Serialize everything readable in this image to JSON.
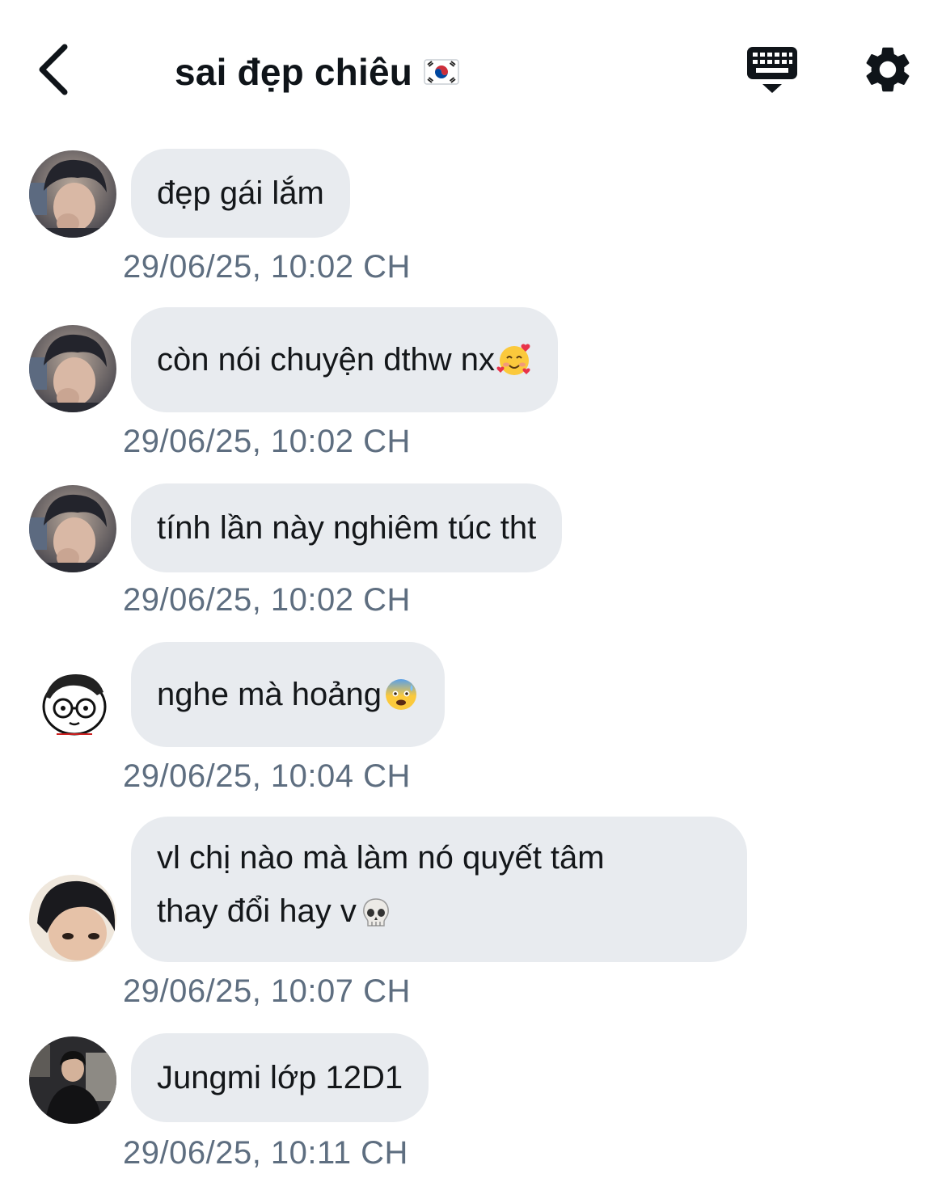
{
  "header": {
    "title": "sai đẹp chiêu",
    "flag_icon": "south-korea-flag-icon",
    "back_icon": "chevron-left-icon",
    "keyboard_icon": "keyboard-dismiss-icon",
    "settings_icon": "gear-icon"
  },
  "messages": [
    {
      "text": "đẹp gái lắm",
      "emoji": "",
      "timestamp": "29/06/25, 10:02 CH",
      "avatar": "avatar-photo-boy"
    },
    {
      "text": "còn nói chuyện dthw nx",
      "emoji": "smiling-face-with-hearts",
      "timestamp": "29/06/25, 10:02 CH",
      "avatar": "avatar-photo-boy"
    },
    {
      "text": "tính lần này nghiêm túc tht",
      "emoji": "",
      "timestamp": "29/06/25, 10:02 CH",
      "avatar": "avatar-photo-boy"
    },
    {
      "text": "nghe mà hoảng",
      "emoji": "anxious-face",
      "timestamp": "29/06/25, 10:04 CH",
      "avatar": "avatar-cartoon"
    },
    {
      "line1": "vl chị nào mà làm nó quyết tâm",
      "line2": "thay đổi hay v",
      "emoji": "skull",
      "timestamp": "29/06/25, 10:07 CH",
      "avatar": "avatar-photo-hair"
    },
    {
      "text": "Jungmi lớp 12D1",
      "emoji": "",
      "timestamp": "29/06/25, 10:11 CH",
      "avatar": "avatar-photo-dark"
    }
  ],
  "colors": {
    "bubble": "#e8ebef",
    "timestamp": "#5e6e80",
    "text": "#14171a"
  }
}
